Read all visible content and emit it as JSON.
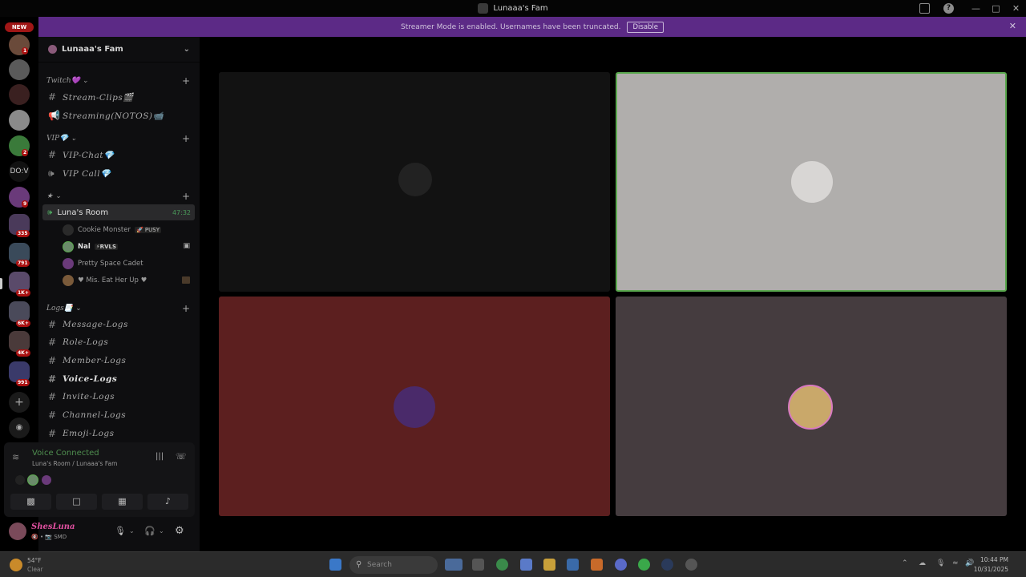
{
  "window": {
    "title": "Lunaaa's Fam"
  },
  "rail": {
    "new_label": "NEW",
    "dov_label": "DO:V",
    "badges": [
      "1",
      "2",
      "9",
      "335",
      "791",
      "1K+",
      "6K+",
      "4K+",
      "991"
    ]
  },
  "banner": {
    "text": "Streamer Mode is enabled. Usernames have been truncated.",
    "disable_label": "Disable"
  },
  "guild": {
    "name": "Lunaaa's Fam"
  },
  "categories": [
    {
      "label": "Twitch💜"
    },
    {
      "label": "VIP💎"
    },
    {
      "label": "★"
    },
    {
      "label": "Logs📑"
    }
  ],
  "channels": {
    "stream_clips": "Stream-Clips🎬",
    "streaming": "Streaming(NOTOS)📹",
    "vip_chat": "VIP-Chat💎",
    "vip_call": "VIP Call💎",
    "message_logs": "Message-Logs",
    "role_logs": "Role-Logs",
    "member_logs": "Member-Logs",
    "voice_logs": "Voice-Logs",
    "invite_logs": "Invite-Logs",
    "channel_logs": "Channel-Logs",
    "emoji_logs": "Emoji-Logs"
  },
  "voice_channel": {
    "name": "Luna's Room",
    "timer": "47:32",
    "users": [
      {
        "name": "Cookie Monster",
        "tag": "🚀 PUSY"
      },
      {
        "name": "Nal",
        "tag": "⚡RVLS"
      },
      {
        "name": "Pretty Space Cadet",
        "tag": ""
      },
      {
        "name": "♥ Mis. Eat Her Up ♥",
        "tag": ""
      }
    ]
  },
  "voice_panel": {
    "status": "Voice Connected",
    "location": "Luna's Room / Lunaaa's Fam"
  },
  "user": {
    "name": "ShesLuna",
    "status": "🔇 • 📷 SMD"
  },
  "taskbar": {
    "temp": "54°F",
    "condition": "Clear",
    "search_placeholder": "Search",
    "time": "10:44 PM",
    "date": "10/31/2025"
  },
  "colors": {
    "banner": "#5c2a86",
    "tile_top_left": "#121212",
    "tile_top_right": "#b0aeac",
    "tile_bottom_left": "#5c1f1f",
    "tile_bottom_right": "#453c3f",
    "speaking_border": "#5aa84e"
  }
}
